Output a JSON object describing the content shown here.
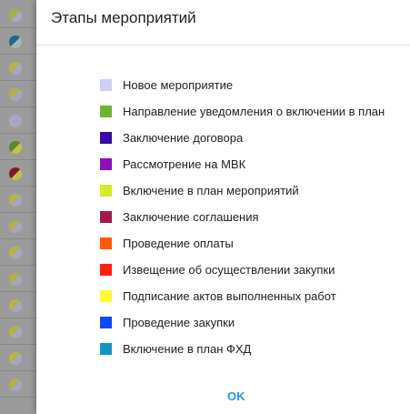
{
  "dialog": {
    "title": "Этапы мероприятий",
    "ok_label": "OK"
  },
  "legend": [
    {
      "label": "Новое мероприятие",
      "color": "#cfd0f7"
    },
    {
      "label": "Направление уведомления о включении в план",
      "color": "#6cb52e"
    },
    {
      "label": "Заключение договора",
      "color": "#3a0aa3"
    },
    {
      "label": "Рассмотрение на МВК",
      "color": "#8a10b8"
    },
    {
      "label": "Включение в план мероприятий",
      "color": "#d4ea2a"
    },
    {
      "label": "Заключение соглашения",
      "color": "#a4174d"
    },
    {
      "label": "Проведение оплаты",
      "color": "#ff5a0a"
    },
    {
      "label": "Извещение об осуществлении закупки",
      "color": "#ff1f0f"
    },
    {
      "label": "Подписание актов выполненных работ",
      "color": "#fffa37"
    },
    {
      "label": "Проведение закупки",
      "color": "#0b49f5"
    },
    {
      "label": "Включение в план ФХД",
      "color": "#1495c7"
    }
  ],
  "background_rows": [
    {
      "colors": [
        "#a7b04a",
        "#b0a8c8"
      ]
    },
    {
      "colors": [
        "#1b6a8c",
        "#a8b2b8"
      ]
    },
    {
      "colors": [
        "#b4b64a",
        "#a9a6c8"
      ]
    },
    {
      "colors": [
        "#b3b04a",
        "#a8a4c8"
      ]
    },
    {
      "colors": [
        "#a7a8c8",
        "#a7a8c8"
      ]
    },
    {
      "colors": [
        "#5b8a2a",
        "#c0c24a"
      ]
    },
    {
      "colors": [
        "#7a1a36",
        "#c4c04a"
      ]
    },
    {
      "colors": [
        "#b7b44a",
        "#a8a6c6"
      ]
    },
    {
      "colors": [
        "#b3b04a",
        "#a8a4c8"
      ]
    },
    {
      "colors": [
        "#b7b44a",
        "#a8a6c6"
      ]
    },
    {
      "colors": [
        "#b3b04a",
        "#a8a4c8"
      ]
    },
    {
      "colors": [
        "#b7b44a",
        "#a8a6c6"
      ]
    },
    {
      "colors": [
        "#b3b04a",
        "#a8a4c8"
      ]
    },
    {
      "colors": [
        "#b7b44a",
        "#a8a6c6"
      ]
    },
    {
      "colors": [
        "#b3b04a",
        "#a8a4c8"
      ]
    }
  ]
}
